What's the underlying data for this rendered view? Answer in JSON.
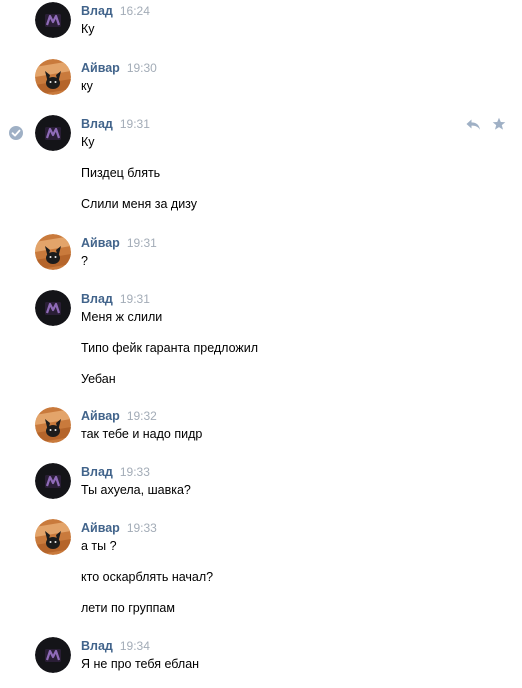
{
  "messages": [
    {
      "author": "Влад",
      "time": "16:24",
      "lines": [
        "Ку"
      ]
    },
    {
      "author": "Айвар",
      "time": "19:30",
      "lines": [
        "ку"
      ]
    },
    {
      "author": "Влад",
      "time": "19:31",
      "lines": [
        "Ку",
        "Пиздец блять",
        "Слили меня за дизу"
      ]
    },
    {
      "author": "Айвар",
      "time": "19:31",
      "lines": [
        "?"
      ]
    },
    {
      "author": "Влад",
      "time": "19:31",
      "lines": [
        "Меня ж слили",
        "Типо фейк гаранта предложил",
        "Уебан"
      ]
    },
    {
      "author": "Айвар",
      "time": "19:32",
      "lines": [
        "так тебе и надо пидр"
      ]
    },
    {
      "author": "Влад",
      "time": "19:33",
      "lines": [
        "Ты ахуела, шавка?"
      ]
    },
    {
      "author": "Айвар",
      "time": "19:33",
      "lines": [
        "а ты ?",
        "кто оскарблять начал?",
        "лети по группам"
      ]
    },
    {
      "author": "Влад",
      "time": "19:34",
      "lines": [
        "Я не про тебя еблан"
      ]
    }
  ],
  "icons": {
    "selected": "check-circle-icon",
    "reply": "reply-icon",
    "favorite": "star-icon"
  },
  "colors": {
    "author": "#42648b",
    "time": "#a3acb7",
    "text": "#000000",
    "icon": "#9fb0c5"
  }
}
